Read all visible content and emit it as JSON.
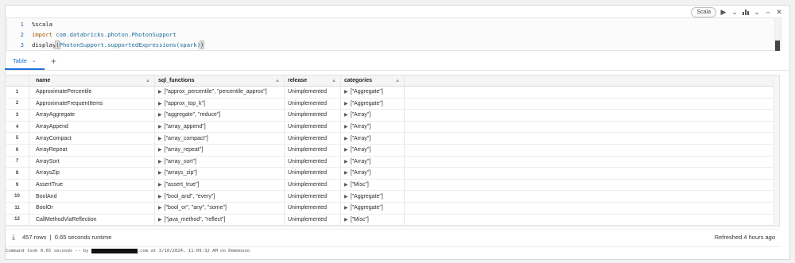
{
  "toolbar": {
    "language": "Scala",
    "run_icon": "play-icon",
    "chart_icon": "chart-icon",
    "chevron_icon": "chevron-down-icon",
    "minimize_icon": "minus-icon",
    "close_icon": "close-icon"
  },
  "editor": {
    "lines": [
      {
        "num": "1",
        "text": "%scala"
      },
      {
        "num": "2",
        "kw": "import",
        "pkg": "com.databricks.photon.PhotonSupport"
      },
      {
        "num": "3",
        "pre": "display",
        "open": "(",
        "call": "PhotonSupport.supportedExpressions(spark)",
        "close": ")"
      }
    ]
  },
  "tabs": [
    {
      "label": "Table"
    }
  ],
  "add_tab_icon": "plus-icon",
  "table": {
    "columns": [
      "name",
      "sql_functions",
      "release",
      "categories"
    ],
    "rows": [
      {
        "idx": "1",
        "name": "ApproximatePercentile",
        "sql": "[\"approx_percentile\", \"percentile_approx\"]",
        "release": "Unimplemented",
        "cat": "[\"Aggregate\"]"
      },
      {
        "idx": "2",
        "name": "ApproximateFrequentItems",
        "sql": "[\"approx_top_k\"]",
        "release": "Unimplemented",
        "cat": "[\"Aggregate\"]"
      },
      {
        "idx": "3",
        "name": "ArrayAggregate",
        "sql": "[\"aggregate\", \"reduce\"]",
        "release": "Unimplemented",
        "cat": "[\"Array\"]"
      },
      {
        "idx": "4",
        "name": "ArrayAppend",
        "sql": "[\"array_append\"]",
        "release": "Unimplemented",
        "cat": "[\"Array\"]"
      },
      {
        "idx": "5",
        "name": "ArrayCompact",
        "sql": "[\"array_compact\"]",
        "release": "Unimplemented",
        "cat": "[\"Array\"]"
      },
      {
        "idx": "6",
        "name": "ArrayRepeat",
        "sql": "[\"array_repeat\"]",
        "release": "Unimplemented",
        "cat": "[\"Array\"]"
      },
      {
        "idx": "7",
        "name": "ArraySort",
        "sql": "[\"array_sort\"]",
        "release": "Unimplemented",
        "cat": "[\"Array\"]"
      },
      {
        "idx": "8",
        "name": "ArraysZip",
        "sql": "[\"arrays_zip\"]",
        "release": "Unimplemented",
        "cat": "[\"Array\"]"
      },
      {
        "idx": "9",
        "name": "AssertTrue",
        "sql": "[\"assert_true\"]",
        "release": "Unimplemented",
        "cat": "[\"Misc\"]"
      },
      {
        "idx": "10",
        "name": "BoolAnd",
        "sql": "[\"bool_and\", \"every\"]",
        "release": "Unimplemented",
        "cat": "[\"Aggregate\"]"
      },
      {
        "idx": "11",
        "name": "BoolOr",
        "sql": "[\"bool_or\", \"any\", \"some\"]",
        "release": "Unimplemented",
        "cat": "[\"Aggregate\"]"
      },
      {
        "idx": "12",
        "name": "CallMethodViaReflection",
        "sql": "[\"java_method\", \"reflect\"]",
        "release": "Unimplemented",
        "cat": "[\"Misc\"]"
      }
    ]
  },
  "footer": {
    "summary": "457 rows  |  0.65 seconds runtime",
    "refreshed": "Refreshed 4 hours ago"
  },
  "status": {
    "prefix": "Command took 0.65 seconds -- by ",
    "suffix": ".com at 3/10/2024, 11:09:32 AM on Demmoooo"
  }
}
